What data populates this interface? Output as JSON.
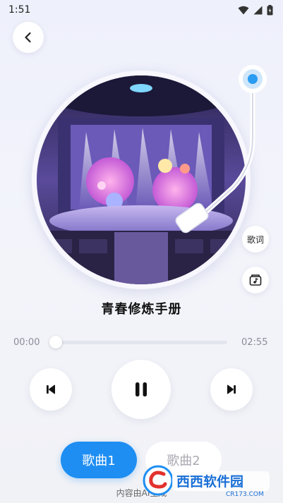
{
  "status_bar": {
    "time": "1:51"
  },
  "song": {
    "title": "青春修炼手册"
  },
  "player": {
    "elapsed": "00:00",
    "duration": "02:55",
    "progress_fraction": 0.0
  },
  "side_buttons": {
    "lyrics_label": "歌词"
  },
  "tabs": [
    {
      "label": "歌曲1",
      "selected": true
    },
    {
      "label": "歌曲2",
      "selected": false
    }
  ],
  "footer": {
    "ai_note": "内容由AI生成"
  },
  "watermark": {
    "brand": "西西软件园",
    "url": "CR173.COM"
  },
  "colors": {
    "accent": "#1e8ef2",
    "tab_inactive_text": "#aaaab2"
  },
  "icons": {
    "back": "chevron-left-icon",
    "prev": "skip-previous-icon",
    "pause": "pause-icon",
    "next": "skip-next-icon",
    "download": "music-download-icon"
  }
}
